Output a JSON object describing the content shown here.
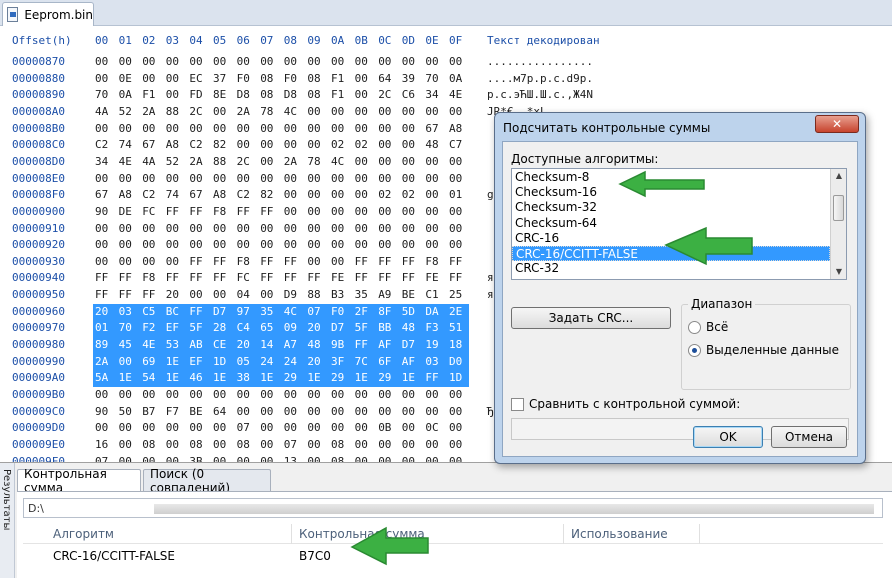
{
  "file_tab": {
    "label": "Eeprom.bin"
  },
  "hex": {
    "header_offset": "Offset(h)",
    "header_columns": [
      "00",
      "01",
      "02",
      "03",
      "04",
      "05",
      "06",
      "07",
      "08",
      "09",
      "0A",
      "0B",
      "0C",
      "0D",
      "0E",
      "0F"
    ],
    "header_text": "Текст декодирован",
    "rows": [
      {
        "offset": "00000870",
        "bytes": [
          "00",
          "00",
          "00",
          "00",
          "00",
          "00",
          "00",
          "00",
          "00",
          "00",
          "00",
          "00",
          "00",
          "00",
          "00",
          "00"
        ],
        "sel_from": -1,
        "text": "................"
      },
      {
        "offset": "00000880",
        "bytes": [
          "00",
          "0E",
          "00",
          "00",
          "EC",
          "37",
          "F0",
          "08",
          "F0",
          "08",
          "F1",
          "00",
          "64",
          "39",
          "70",
          "0A"
        ],
        "sel_from": -1,
        "text": "....м7р.р.с.d9p."
      },
      {
        "offset": "00000890",
        "bytes": [
          "70",
          "0A",
          "F1",
          "00",
          "FD",
          "8E",
          "D8",
          "08",
          "D8",
          "08",
          "F1",
          "00",
          "2C",
          "C6",
          "34",
          "4E"
        ],
        "sel_from": -1,
        "text": "p.с.эЋШ.Ш.с.,Ж4N"
      },
      {
        "offset": "000008A0",
        "bytes": [
          "4A",
          "52",
          "2A",
          "88",
          "2C",
          "00",
          "2A",
          "78",
          "4C",
          "00",
          "00",
          "00",
          "00",
          "00",
          "00",
          "00"
        ],
        "sel_from": -1,
        "text": "JR*€,.*xL......."
      },
      {
        "offset": "000008B0",
        "bytes": [
          "00",
          "00",
          "00",
          "00",
          "00",
          "00",
          "00",
          "00",
          "00",
          "00",
          "00",
          "00",
          "00",
          "00",
          "67",
          "A8"
        ],
        "sel_from": -1,
        "text": ""
      },
      {
        "offset": "000008C0",
        "bytes": [
          "C2",
          "74",
          "67",
          "A8",
          "C2",
          "82",
          "00",
          "00",
          "00",
          "00",
          "02",
          "02",
          "00",
          "00",
          "48",
          "C7"
        ],
        "sel_from": -1,
        "text": ""
      },
      {
        "offset": "000008D0",
        "bytes": [
          "34",
          "4E",
          "4A",
          "52",
          "2A",
          "88",
          "2C",
          "00",
          "2A",
          "78",
          "4C",
          "00",
          "00",
          "00",
          "00",
          "00"
        ],
        "sel_from": -1,
        "text": ""
      },
      {
        "offset": "000008E0",
        "bytes": [
          "00",
          "00",
          "00",
          "00",
          "00",
          "00",
          "00",
          "00",
          "00",
          "00",
          "00",
          "00",
          "00",
          "00",
          "00",
          "00"
        ],
        "sel_from": -1,
        "text": ""
      },
      {
        "offset": "000008F0",
        "bytes": [
          "67",
          "A8",
          "C2",
          "74",
          "67",
          "A8",
          "C2",
          "82",
          "00",
          "00",
          "00",
          "00",
          "02",
          "02",
          "00",
          "01"
        ],
        "sel_from": -1,
        "text": "g"
      },
      {
        "offset": "00000900",
        "bytes": [
          "90",
          "DE",
          "FC",
          "FF",
          "FF",
          "F8",
          "FF",
          "FF",
          "00",
          "00",
          "00",
          "00",
          "00",
          "00",
          "00",
          "00"
        ],
        "sel_from": -1,
        "text": ""
      },
      {
        "offset": "00000910",
        "bytes": [
          "00",
          "00",
          "00",
          "00",
          "00",
          "00",
          "00",
          "00",
          "00",
          "00",
          "00",
          "00",
          "00",
          "00",
          "00",
          "00"
        ],
        "sel_from": -1,
        "text": ""
      },
      {
        "offset": "00000920",
        "bytes": [
          "00",
          "00",
          "00",
          "00",
          "00",
          "00",
          "00",
          "00",
          "00",
          "00",
          "00",
          "00",
          "00",
          "00",
          "00",
          "00"
        ],
        "sel_from": -1,
        "text": ""
      },
      {
        "offset": "00000930",
        "bytes": [
          "00",
          "00",
          "00",
          "00",
          "FF",
          "FF",
          "F8",
          "FF",
          "FF",
          "00",
          "00",
          "FF",
          "FF",
          "FF",
          "F8",
          "FF"
        ],
        "sel_from": -1,
        "text": ""
      },
      {
        "offset": "00000940",
        "bytes": [
          "FF",
          "FF",
          "F8",
          "FF",
          "FF",
          "FF",
          "FC",
          "FF",
          "FF",
          "FF",
          "FE",
          "FF",
          "FF",
          "FF",
          "FE",
          "FF"
        ],
        "sel_from": -1,
        "text": "я"
      },
      {
        "offset": "00000950",
        "bytes": [
          "FF",
          "FF",
          "FF",
          "20",
          "00",
          "00",
          "04",
          "00",
          "D9",
          "88",
          "B3",
          "35",
          "A9",
          "BE",
          "C1",
          "25"
        ],
        "sel_from": -1,
        "text": "я"
      },
      {
        "offset": "00000960",
        "bytes": [
          "20",
          "03",
          "C5",
          "BC",
          "FF",
          "D7",
          "97",
          "35",
          "4C",
          "07",
          "F0",
          "2F",
          "8F",
          "5D",
          "DA",
          "2E"
        ],
        "sel_from": 0,
        "text": ""
      },
      {
        "offset": "00000970",
        "bytes": [
          "01",
          "70",
          "F2",
          "EF",
          "5F",
          "28",
          "C4",
          "65",
          "09",
          "20",
          "D7",
          "5F",
          "BB",
          "48",
          "F3",
          "51"
        ],
        "sel_from": 0,
        "text": ""
      },
      {
        "offset": "00000980",
        "bytes": [
          "89",
          "45",
          "4E",
          "53",
          "AB",
          "CE",
          "20",
          "14",
          "A7",
          "48",
          "9B",
          "FF",
          "AF",
          "D7",
          "19",
          "18"
        ],
        "sel_from": 0,
        "text": ""
      },
      {
        "offset": "00000990",
        "bytes": [
          "2A",
          "00",
          "69",
          "1E",
          "EF",
          "1D",
          "05",
          "24",
          "24",
          "20",
          "3F",
          "7C",
          "6F",
          "AF",
          "03",
          "D0"
        ],
        "sel_from": 0,
        "text": ""
      },
      {
        "offset": "000009A0",
        "bytes": [
          "5A",
          "1E",
          "54",
          "1E",
          "46",
          "1E",
          "38",
          "1E",
          "29",
          "1E",
          "29",
          "1E",
          "29",
          "1E",
          "FF",
          "1D"
        ],
        "sel_from": 0,
        "text": ""
      },
      {
        "offset": "000009B0",
        "bytes": [
          "00",
          "00",
          "00",
          "00",
          "00",
          "00",
          "00",
          "00",
          "00",
          "00",
          "00",
          "00",
          "00",
          "00",
          "00",
          "00"
        ],
        "sel_from": -1,
        "text": ""
      },
      {
        "offset": "000009C0",
        "bytes": [
          "90",
          "50",
          "B7",
          "F7",
          "BE",
          "64",
          "00",
          "00",
          "00",
          "00",
          "00",
          "00",
          "00",
          "00",
          "00",
          "00"
        ],
        "sel_from": -1,
        "text": "Ђ"
      },
      {
        "offset": "000009D0",
        "bytes": [
          "00",
          "00",
          "00",
          "00",
          "00",
          "00",
          "07",
          "00",
          "00",
          "00",
          "00",
          "00",
          "0B",
          "00",
          "0C",
          "00"
        ],
        "sel_from": -1,
        "text": ""
      },
      {
        "offset": "000009E0",
        "bytes": [
          "16",
          "00",
          "08",
          "00",
          "08",
          "00",
          "08",
          "00",
          "07",
          "00",
          "08",
          "00",
          "00",
          "00",
          "00",
          "00"
        ],
        "sel_from": -1,
        "text": ""
      },
      {
        "offset": "000009F0",
        "bytes": [
          "07",
          "00",
          "00",
          "00",
          "3B",
          "00",
          "00",
          "00",
          "13",
          "00",
          "08",
          "00",
          "00",
          "00",
          "00",
          "00"
        ],
        "sel_from": -1,
        "text": ""
      }
    ]
  },
  "bottom": {
    "vertical_tab": "Результаты",
    "tabs": [
      {
        "label": "Контрольная сумма",
        "active": true
      },
      {
        "label": "Поиск (0 совпадений)",
        "active": false
      }
    ],
    "path_prefix": "D:\\",
    "columns": [
      "Алгоритм",
      "Контрольная сумма",
      "Использование"
    ],
    "result": {
      "algorithm": "CRC-16/CCITT-FALSE",
      "checksum": "B7C0",
      "usage": ""
    }
  },
  "dialog": {
    "title": "Подсчитать контрольные суммы",
    "close_label": "✕",
    "algorithms_label": "Доступные алгоритмы:",
    "algorithms": [
      "Checksum-8",
      "Checksum-16",
      "Checksum-32",
      "Checksum-64",
      "CRC-16",
      "CRC-16/CCITT-FALSE",
      "CRC-32"
    ],
    "selected_algorithm": "CRC-16/CCITT-FALSE",
    "set_crc_button": "Задать CRC...",
    "range_label": "Диапазон",
    "range_all": "Всё",
    "range_selected": "Выделенные данные",
    "range_value": "selected",
    "compare_label": "Сравнить с контрольной суммой:",
    "compare_checked": false,
    "compare_value": "",
    "ok_button": "OK",
    "cancel_button": "Отмена"
  },
  "colors": {
    "selection": "#3399ff",
    "offset_text": "#1c4fa8",
    "annotation_arrow": "#3cb043"
  }
}
